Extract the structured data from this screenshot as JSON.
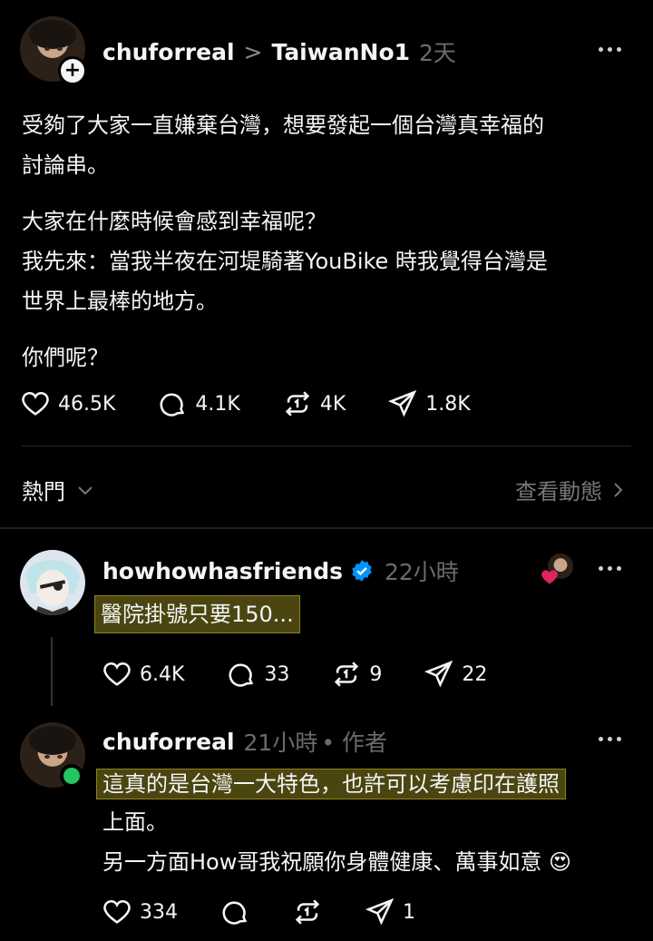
{
  "post": {
    "username": "chuforreal",
    "separator": ">",
    "community": "TaiwanNo1",
    "time": "2天",
    "paragraphs": [
      [
        "受夠了大家一直嫌棄台灣，想要發起一個台灣真幸福的",
        "討論串。"
      ],
      [
        "大家在什麼時候會感到幸福呢？",
        "我先來：當我半夜在河堤騎著YouBike 時我覺得台灣是",
        "世界上最棒的地方。"
      ],
      [
        "你們呢？"
      ]
    ],
    "stats": {
      "likes": "46.5K",
      "comments": "4.1K",
      "reposts": "4K",
      "shares": "1.8K"
    },
    "icons": [
      "heart-icon",
      "comment-icon",
      "repost-icon",
      "share-icon"
    ]
  },
  "sort": {
    "label": "熱門",
    "activity_label": "查看動態"
  },
  "replies": [
    {
      "username": "howhowhasfriends",
      "verified": true,
      "time": "22小時",
      "text": "醫院掛號只要150...",
      "stats": {
        "likes": "6.4K",
        "comments": "33",
        "reposts": "9",
        "shares": "22"
      }
    },
    {
      "username": "chuforreal",
      "time": "21小時",
      "author_tag": "• 作者",
      "lines": [
        "這真的是台灣一大特色，也許可以考慮印在護照",
        "上面。",
        "另一方面How哥我祝願你身體健康、萬事如意 😍"
      ],
      "stats": {
        "likes": "334",
        "comments": "",
        "reposts": "",
        "shares": "1"
      }
    }
  ],
  "colors": {
    "background": "#000000",
    "text": "#f3f5f7",
    "muted": "#6b6b6b",
    "verified": "#0095f6",
    "highlight": "#4b4510",
    "online": "#22c55e",
    "heart": "#e0245e"
  }
}
